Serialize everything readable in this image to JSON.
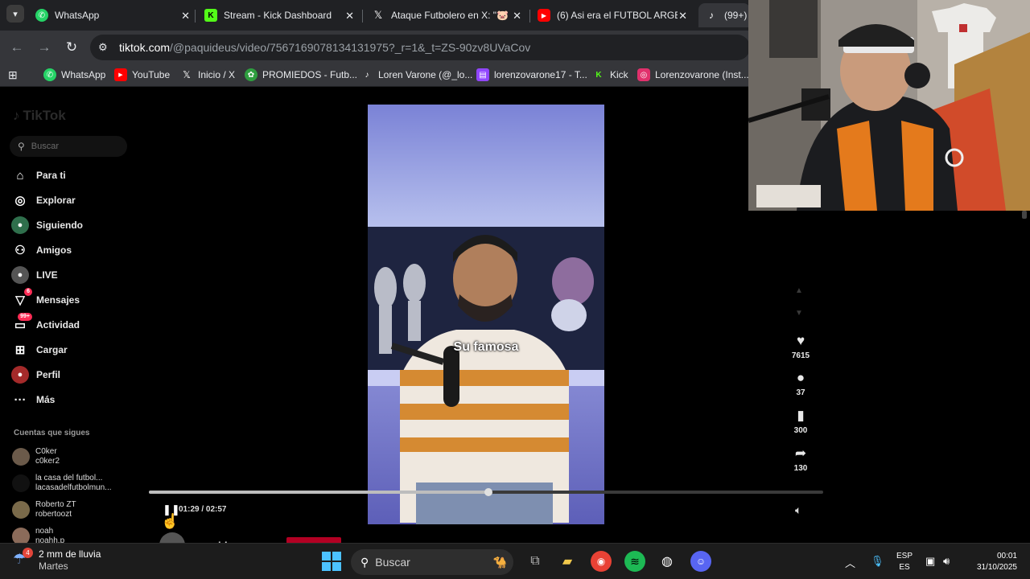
{
  "browser": {
    "tabs": [
      {
        "title": "WhatsApp",
        "icon": "whatsapp-icon",
        "color": "#25d366"
      },
      {
        "title": "Stream - Kick Dashboard",
        "icon": "kick-icon",
        "color": "#53fc18"
      },
      {
        "title": "Ataque Futbolero en X: \"🐷",
        "icon": "x-icon",
        "color": "#ffffff"
      },
      {
        "title": "(6) Asi era el FUTBOL ARGEN",
        "icon": "youtube-icon",
        "color": "#ff0000"
      },
      {
        "title": "(99+)",
        "icon": "tiktok-icon",
        "color": "#ffffff"
      }
    ],
    "url_domain": "tiktok.com",
    "url_path": "/@paquideus/video/7567169078134131975?_r=1&_t=ZS-90zv8UVaCov",
    "bookmarks": [
      {
        "label": "WhatsApp",
        "icon": "whatsapp-icon",
        "color": "#25d366"
      },
      {
        "label": "YouTube",
        "icon": "youtube-icon",
        "color": "#ff0000"
      },
      {
        "label": "Inicio / X",
        "icon": "x-icon",
        "color": "#ffffff"
      },
      {
        "label": "PROMIEDOS - Futb...",
        "icon": "promiedos-icon",
        "color": "#2e9e3f"
      },
      {
        "label": "Loren Varone (@_lo...",
        "icon": "tiktok-icon",
        "color": "#ffffff"
      },
      {
        "label": "lorenzovarone17 - T...",
        "icon": "twitch-icon",
        "color": "#9146ff"
      },
      {
        "label": "Kick",
        "icon": "kick-icon",
        "color": "#53fc18"
      },
      {
        "label": "Lorenzovarone (Inst...",
        "icon": "instagram-icon",
        "color": "#e1306c"
      }
    ]
  },
  "tiktok": {
    "logo": "TikTok",
    "search_placeholder": "Buscar",
    "nav": [
      {
        "label": "Para ti",
        "icon": "home-icon"
      },
      {
        "label": "Explorar",
        "icon": "compass-icon"
      },
      {
        "label": "Siguiendo",
        "icon": "following-icon"
      },
      {
        "label": "Amigos",
        "icon": "friends-icon"
      },
      {
        "label": "LIVE",
        "icon": "live-icon"
      },
      {
        "label": "Mensajes",
        "icon": "messages-icon",
        "badge": "6"
      },
      {
        "label": "Actividad",
        "icon": "activity-icon",
        "badge": "99+"
      },
      {
        "label": "Cargar",
        "icon": "upload-icon"
      },
      {
        "label": "Perfil",
        "icon": "profile-icon"
      },
      {
        "label": "Más",
        "icon": "more-icon"
      }
    ],
    "following_title": "Cuentas que sigues",
    "following": [
      {
        "name": "C0ker",
        "handle": "c0ker2"
      },
      {
        "name": "la casa del futbol...",
        "handle": "lacasadelfutbolmun..."
      },
      {
        "name": "Roberto ZT",
        "handle": "robertoozt"
      },
      {
        "name": "noah",
        "handle": "noahh.p"
      }
    ],
    "video": {
      "subtitle": "Su famosa",
      "time": "01:29 / 02:57",
      "progress": 0.503,
      "author": "paquideus"
    },
    "actions": [
      {
        "icon": "heart-icon",
        "count": "7615"
      },
      {
        "icon": "comment-icon",
        "count": "37"
      },
      {
        "icon": "bookmark-icon",
        "count": "300"
      },
      {
        "icon": "share-icon",
        "count": "130"
      }
    ]
  },
  "taskbar": {
    "weather_badge": "4",
    "weather_text": "2 mm de lluvia",
    "weather_sub": "Martes",
    "search_placeholder": "Buscar",
    "lang_top": "ESP",
    "lang_bottom": "ES",
    "time": "00:01",
    "date": "31/10/2025"
  }
}
